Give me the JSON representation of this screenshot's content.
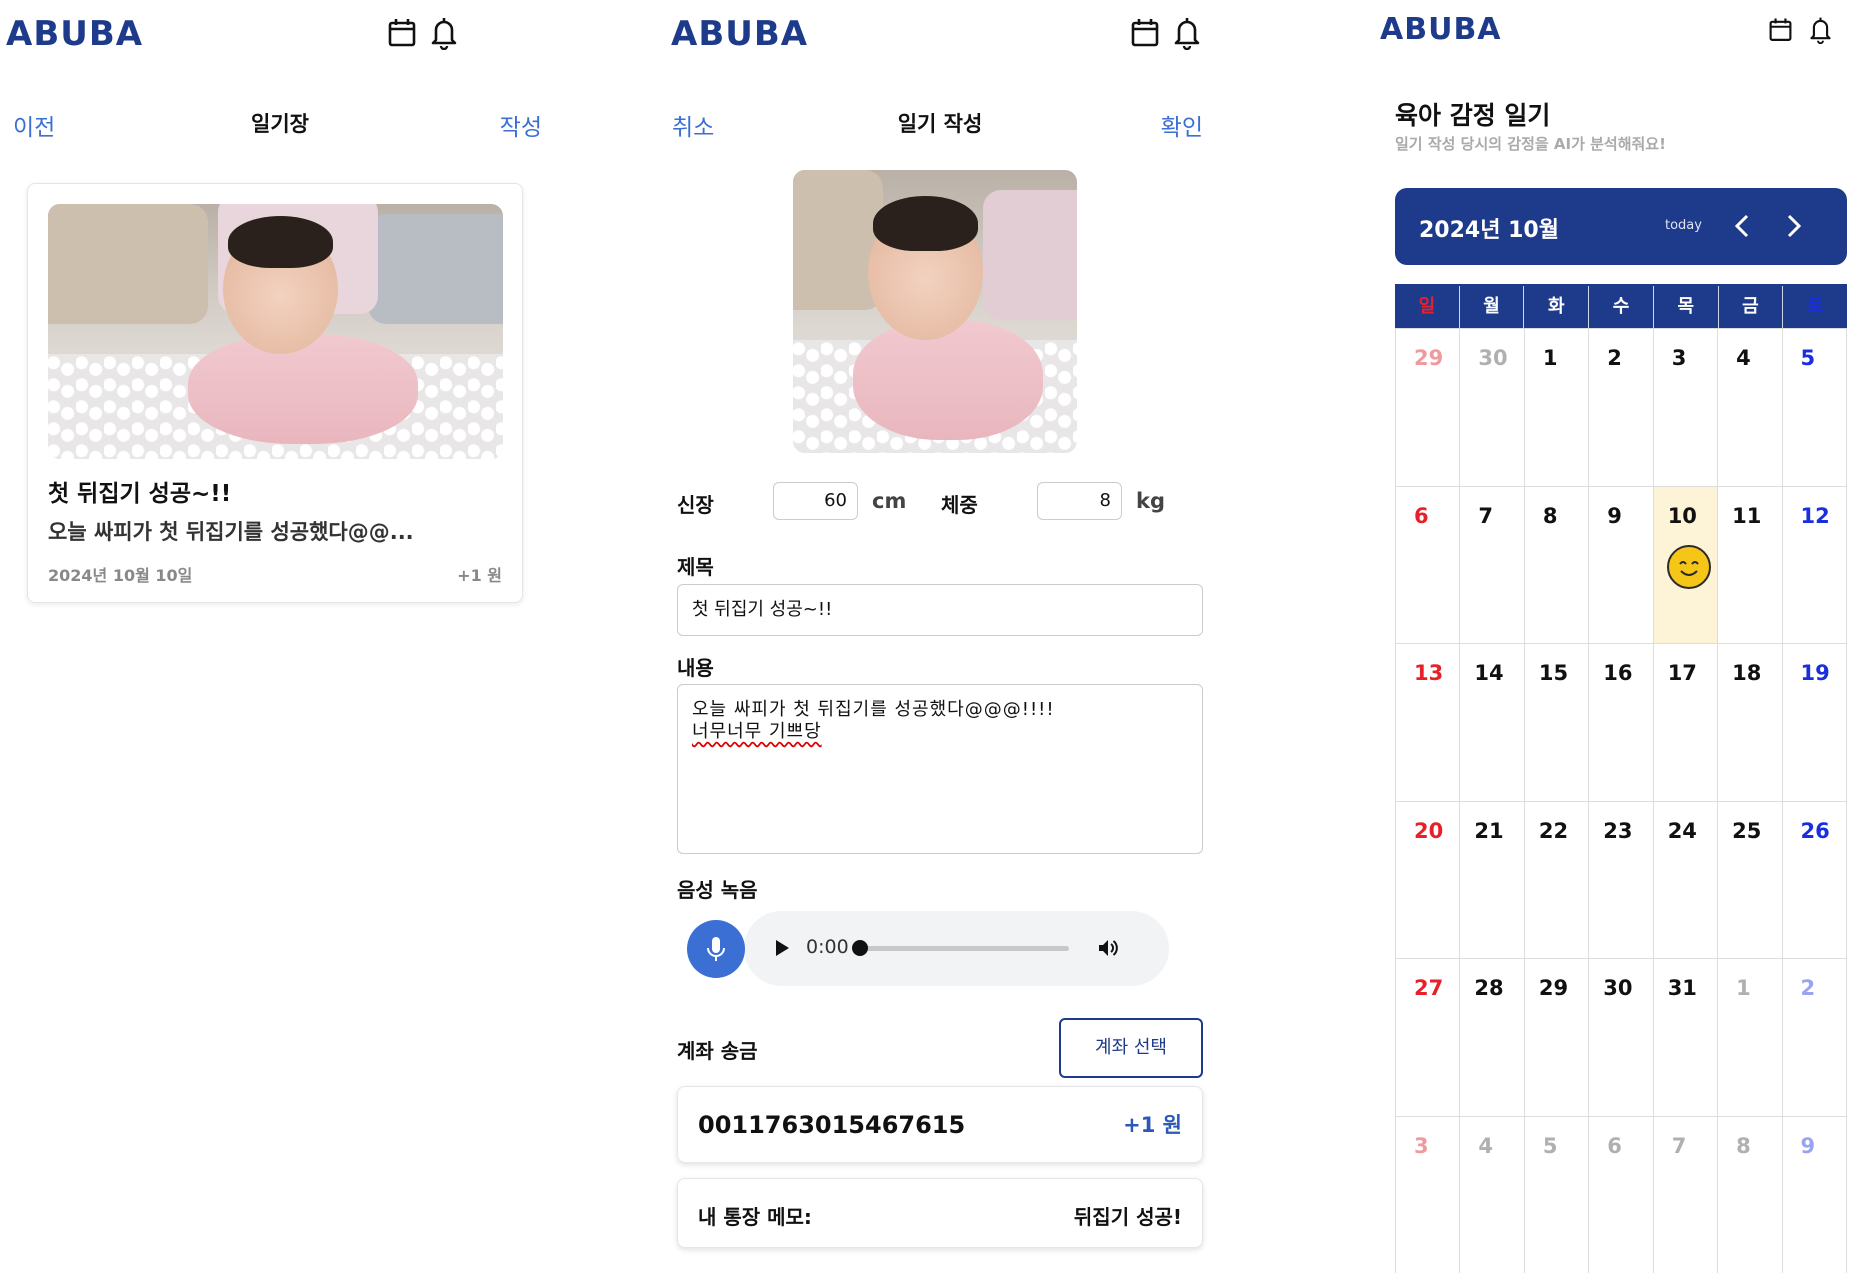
{
  "brand": "ABUBA",
  "panel1": {
    "nav": {
      "prev": "이전",
      "title": "일기장",
      "write": "작성"
    },
    "card": {
      "title": "첫 뒤집기 성공~!!",
      "preview": "오늘 싸피가 첫 뒤집기를 성공했다@@...",
      "date": "2024년 10월 10일",
      "amount": "+1 원"
    }
  },
  "panel2": {
    "nav": {
      "cancel": "취소",
      "title": "일기 작성",
      "confirm": "확인"
    },
    "height_label": "신장",
    "height_value": "60",
    "height_unit": "cm",
    "weight_label": "체중",
    "weight_value": "8",
    "weight_unit": "kg",
    "title_label": "제목",
    "title_value": "첫 뒤집기 성공~!!",
    "content_label": "내용",
    "content_line1": "오늘 싸피가 첫 뒤집기를 성공했다@@@!!!!",
    "content_line2": "너무너무 기쁘당",
    "voice_label": "음성 녹음",
    "player_time": "0:00",
    "transfer_label": "계좌 송금",
    "account_select": "계좌 선택",
    "account_number": "0011763015467615",
    "account_amount": "+1 원",
    "memo_label": "내 통장 메모:",
    "memo_value": "뒤집기 성공!"
  },
  "panel3": {
    "title": "육아 감정 일기",
    "subtitle": "일기 작성 당시의 감정을 AI가 분석해줘요!",
    "month": "2024년 10월",
    "today": "today",
    "weekdays": [
      "일",
      "월",
      "화",
      "수",
      "목",
      "금",
      "토"
    ],
    "weeks": [
      [
        "29",
        "30",
        "1",
        "2",
        "3",
        "4",
        "5"
      ],
      [
        "6",
        "7",
        "8",
        "9",
        "10",
        "11",
        "12"
      ],
      [
        "13",
        "14",
        "15",
        "16",
        "17",
        "18",
        "19"
      ],
      [
        "20",
        "21",
        "22",
        "23",
        "24",
        "25",
        "26"
      ],
      [
        "27",
        "28",
        "29",
        "30",
        "31",
        "1",
        "2"
      ],
      [
        "3",
        "4",
        "5",
        "6",
        "7",
        "8",
        "9"
      ]
    ],
    "emotion_day": "10",
    "emotion_icon": "smiley-icon"
  },
  "colors": {
    "brand_blue": "#1e3a8a",
    "link_blue": "#3b6fd4",
    "sunday_red": "#e8202a",
    "saturday_blue": "#1a2ee0",
    "today_bg": "#fdf4d7"
  }
}
